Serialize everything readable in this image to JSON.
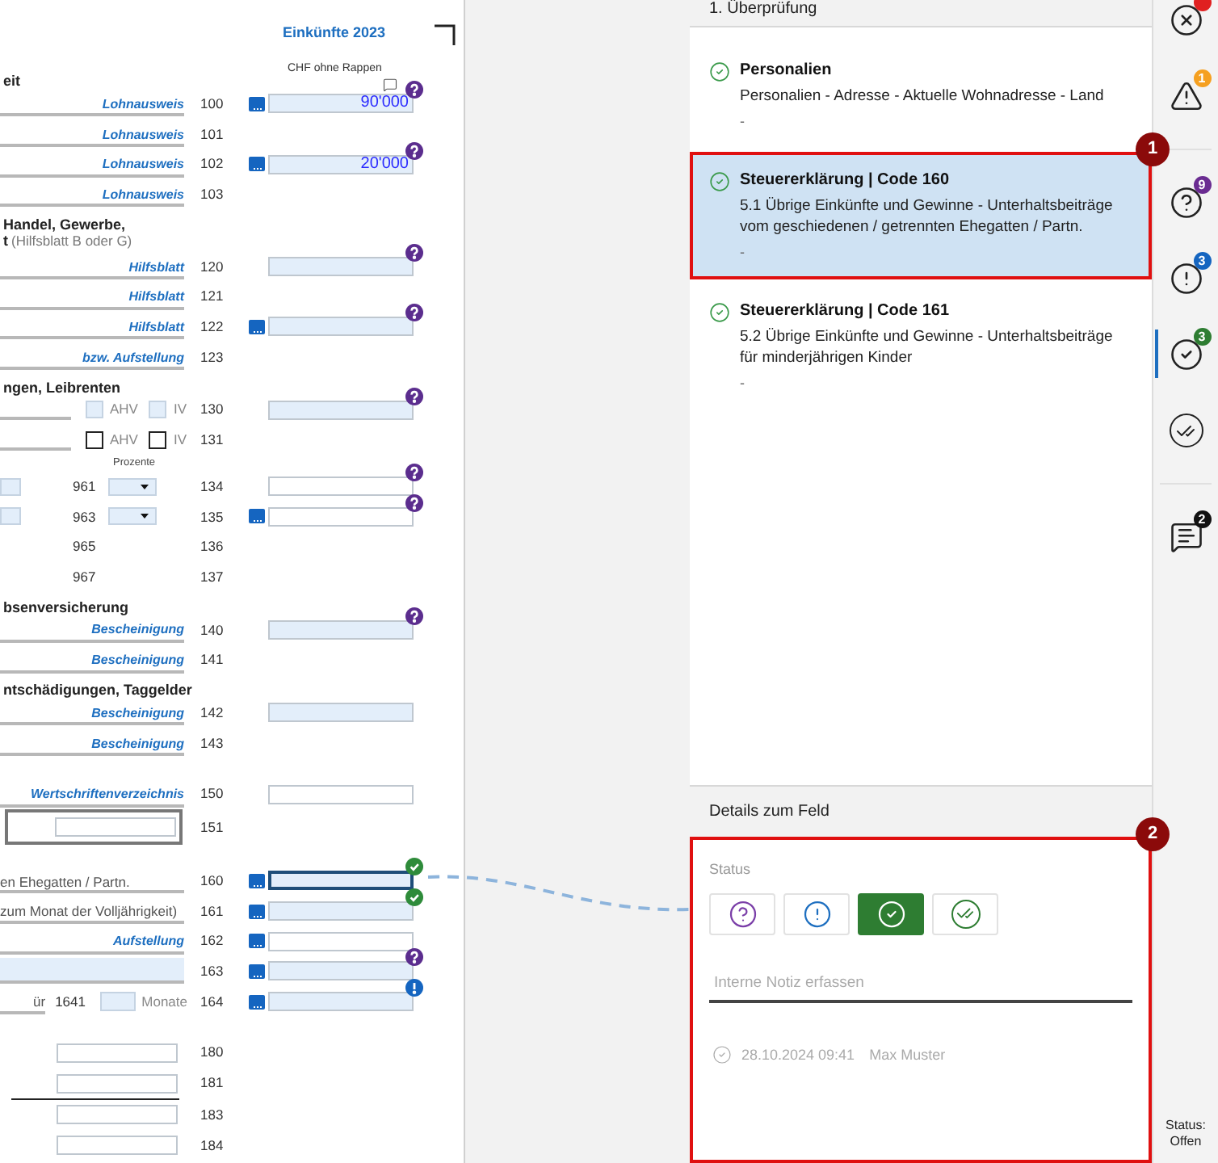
{
  "document": {
    "title": "Einkünfte 2023",
    "unit_note": "CHF ohne Rappen",
    "rows": [
      {
        "kind": "heading",
        "text": "eit"
      },
      {
        "kind": "line",
        "link": "Lohnausweis",
        "code": "100",
        "field": {
          "filled": true,
          "value": "90'000",
          "button": true,
          "badge": {
            "kind": "question"
          },
          "comment": true,
          "selected": false
        }
      },
      {
        "kind": "line",
        "link": "Lohnausweis",
        "code": "101"
      },
      {
        "kind": "line",
        "link": "Lohnausweis",
        "code": "102",
        "field": {
          "filled": true,
          "value": "20'000",
          "button": true,
          "badge": {
            "kind": "question"
          },
          "selected": false
        }
      },
      {
        "kind": "line",
        "link": "Lohnausweis",
        "code": "103"
      },
      {
        "kind": "heading",
        "text": "Handel, Gewerbe,"
      },
      {
        "kind": "subheading",
        "text": "t",
        "note": "(Hilfsblatt B oder G)"
      },
      {
        "kind": "line",
        "link": "Hilfsblatt",
        "code": "120",
        "field": {
          "filled": true,
          "badge": {
            "kind": "question"
          },
          "selected": false
        }
      },
      {
        "kind": "line",
        "link": "Hilfsblatt",
        "code": "121"
      },
      {
        "kind": "line",
        "link": "Hilfsblatt",
        "code": "122",
        "field": {
          "filled": true,
          "button": true,
          "badge": {
            "kind": "question"
          },
          "selected": false
        }
      },
      {
        "kind": "line",
        "link": "bzw. Aufstellung",
        "code": "123"
      },
      {
        "kind": "heading",
        "text": "ngen, Leibrenten"
      },
      {
        "kind": "checkboxes",
        "options": [
          {
            "label": "AHV",
            "filled": true
          },
          {
            "label": "IV",
            "filled": true
          }
        ],
        "code": "130",
        "field": {
          "filled": true,
          "badge": {
            "kind": "question"
          },
          "selected": false
        }
      },
      {
        "kind": "checkboxes",
        "options": [
          {
            "label": "AHV",
            "filled": false
          },
          {
            "label": "IV",
            "filled": false
          }
        ],
        "code": "131"
      },
      {
        "kind": "caption",
        "text": "Prozente"
      },
      {
        "kind": "dropdown",
        "subcode": "961",
        "code": "134",
        "field": {
          "filled": false,
          "badge": {
            "kind": "question"
          },
          "selected": false
        }
      },
      {
        "kind": "dropdown",
        "subcode": "963",
        "code": "135",
        "field": {
          "filled": false,
          "button": true,
          "badge": {
            "kind": "question"
          },
          "selected": false
        }
      },
      {
        "kind": "subcode",
        "subcode": "965",
        "code": "136"
      },
      {
        "kind": "subcode",
        "subcode": "967",
        "code": "137"
      },
      {
        "kind": "heading",
        "text": "bsenversicherung"
      },
      {
        "kind": "line",
        "link": "Bescheinigung",
        "code": "140",
        "field": {
          "filled": true,
          "badge": {
            "kind": "question"
          },
          "selected": false
        }
      },
      {
        "kind": "line",
        "link": "Bescheinigung",
        "code": "141"
      },
      {
        "kind": "heading",
        "text": "ntschädigungen, Taggelder"
      },
      {
        "kind": "line",
        "link": "Bescheinigung",
        "code": "142",
        "field": {
          "filled": true,
          "selected": false
        }
      },
      {
        "kind": "line",
        "link": "Bescheinigung",
        "code": "143"
      },
      {
        "kind": "blank"
      },
      {
        "kind": "line",
        "link": "Wertschriftenverzeichnis",
        "code": "150",
        "field": {
          "filled": false,
          "selected": false
        }
      },
      {
        "kind": "boxed",
        "code": "151"
      },
      {
        "kind": "blank"
      },
      {
        "kind": "line",
        "label": "en Ehegatten / Partn.",
        "code": "160",
        "field": {
          "filled": true,
          "button": true,
          "badge": {
            "kind": "check"
          },
          "selected": true
        }
      },
      {
        "kind": "line",
        "label": "zum Monat der Volljährigkeit)",
        "code": "161",
        "field": {
          "filled": true,
          "button": true,
          "badge": {
            "kind": "check"
          },
          "selected": false
        }
      },
      {
        "kind": "line",
        "link": "Aufstellung",
        "code": "162",
        "field": {
          "filled": false,
          "button": true,
          "selected": false
        }
      },
      {
        "kind": "input",
        "code": "163",
        "field": {
          "filled": true,
          "button": true,
          "badge": {
            "kind": "question"
          },
          "selected": false
        }
      },
      {
        "kind": "months",
        "label": "ür",
        "subcode": "1641",
        "unit": "Monate",
        "code": "164",
        "field": {
          "filled": true,
          "button": true,
          "badge": {
            "kind": "info"
          },
          "selected": false
        }
      },
      {
        "kind": "blank"
      },
      {
        "kind": "amount",
        "code": "180"
      },
      {
        "kind": "amount",
        "code": "181"
      },
      {
        "kind": "rule"
      },
      {
        "kind": "amount",
        "code": "183"
      },
      {
        "kind": "amount",
        "code": "184"
      }
    ]
  },
  "review": {
    "title": "1. Überprüfung",
    "items": [
      {
        "title": "Personalien",
        "description": "Personalien - Adresse - Aktuelle Wohnadresse - Land",
        "note": "-",
        "selected": false
      },
      {
        "title": "Steuererklärung | Code 160",
        "description": "5.1 Übrige Einkünfte und Gewinne - Unterhaltsbeiträge vom geschiedenen / getrennten Ehegatten / Partn.",
        "note": "-",
        "selected": true,
        "callout": "1"
      },
      {
        "title": "Steuererklärung | Code 161",
        "description": "5.2 Übrige Einkünfte und Gewinne - Unterhaltsbeiträge für minderjährigen Kinder",
        "note": "-",
        "selected": false
      }
    ]
  },
  "details": {
    "title": "Details zum Feld",
    "callout": "2",
    "status_label": "Status",
    "status_options": [
      {
        "kind": "question",
        "selected": false
      },
      {
        "kind": "exclamation",
        "selected": false
      },
      {
        "kind": "check",
        "selected": true
      },
      {
        "kind": "double_check",
        "selected": false
      }
    ],
    "note_placeholder": "Interne Notiz erfassen",
    "history": [
      {
        "timestamp": "28.10.2024 09:41",
        "author": "Max Muster"
      }
    ]
  },
  "sidebar": {
    "buttons": [
      {
        "kind": "close",
        "color": "#e02020",
        "selected": false
      },
      {
        "kind": "warning",
        "count": "1",
        "color": "#f5a020",
        "selected": false
      },
      {
        "kind": "divider"
      },
      {
        "kind": "question",
        "count": "9",
        "color": "#6a2c91",
        "selected": false
      },
      {
        "kind": "exclamation",
        "count": "3",
        "color": "#1565c0",
        "selected": false
      },
      {
        "kind": "check",
        "count": "3",
        "color": "#2e7d32",
        "selected": true
      },
      {
        "kind": "double_check",
        "selected": false
      },
      {
        "kind": "divider"
      },
      {
        "kind": "comment",
        "count": "2",
        "color": "#111111",
        "selected": false
      }
    ],
    "status_label": "Status:",
    "status_value": "Offen"
  }
}
